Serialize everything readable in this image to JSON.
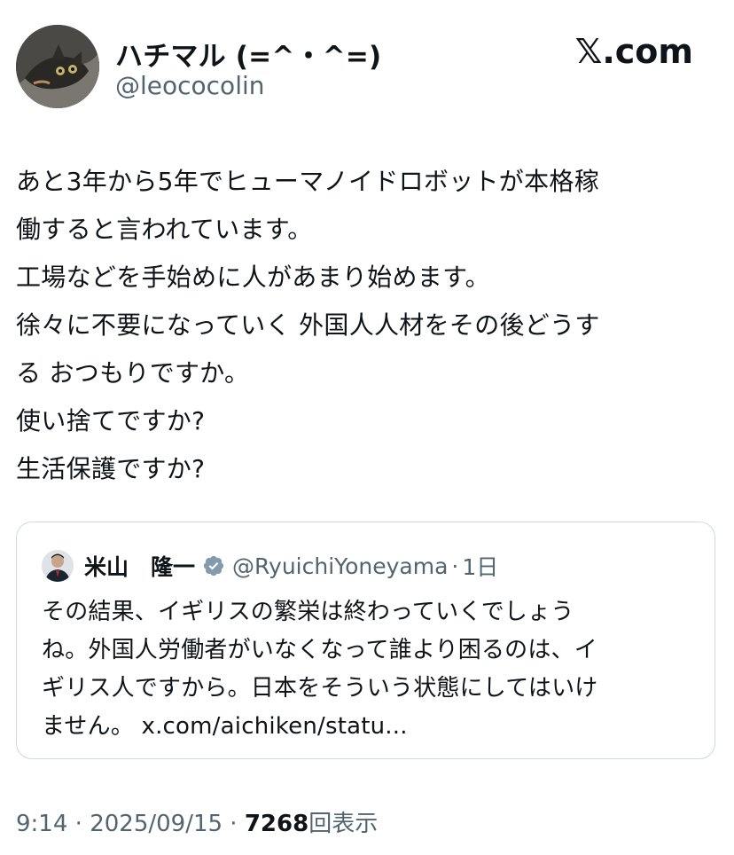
{
  "header": {
    "display_name": "ハチマル (=^・^=)",
    "handle": "@leococolin",
    "site_logo": "𝕏.com",
    "avatar_icon": "cat-avatar"
  },
  "post": {
    "lines": [
      "あと3年から5年でヒューマノイドロボットが本格稼",
      "働すると言われています。",
      "工場などを手始めに人があまり始めます。",
      "徐々に不要になっていく 外国人人材をその後どうす",
      "る おつもりですか。",
      "使い捨てですか?",
      "生活保護ですか?"
    ]
  },
  "quoted": {
    "display_name": "米山　隆一",
    "verified_icon": "verified-badge-icon",
    "handle": "@RyuichiYoneyama",
    "separator": "·",
    "time": "1日",
    "lines": [
      "その結果、イギリスの繁栄は終わっていくでしょう",
      "ね。外国人労働者がいなくなって誰より困るのは、イ",
      "ギリス人ですから。日本をそういう状態にしてはいけ"
    ],
    "last_line_text": "ません。",
    "link": "x.com/aichiken/statu..."
  },
  "meta": {
    "time": "9:14",
    "sep1": " · ",
    "date": "2025/09/15",
    "sep2": " · ",
    "views_count": "7268",
    "views_label": "回表示"
  },
  "colors": {
    "text": "#0f1419",
    "secondary": "#536471",
    "border": "#cfd9de",
    "verified_gray": "#829aab"
  }
}
